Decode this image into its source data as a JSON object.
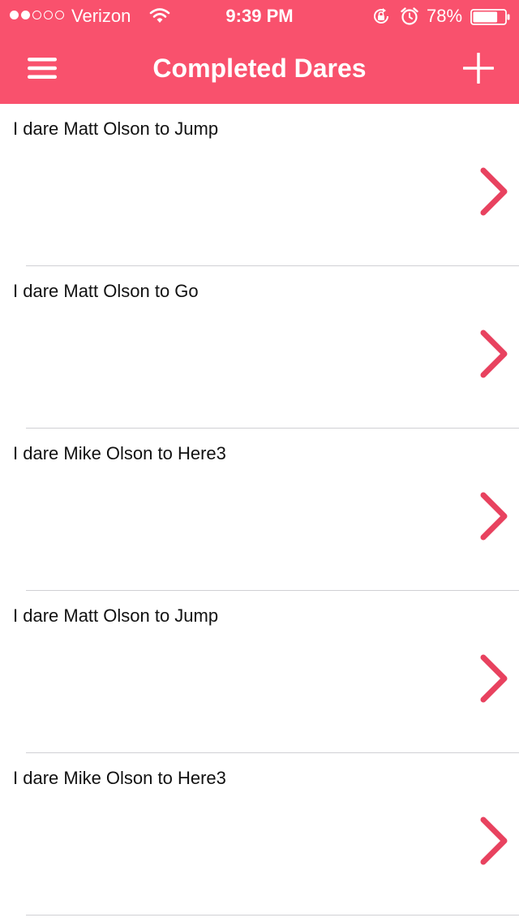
{
  "status_bar": {
    "signal_filled": 2,
    "signal_total": 5,
    "carrier": "Verizon",
    "time": "9:39 PM",
    "battery": "78%",
    "battery_level": 0.78
  },
  "nav": {
    "title": "Completed Dares",
    "menu_icon": "hamburger-menu-icon",
    "add_icon": "plus-icon"
  },
  "dares": [
    {
      "text": "I dare Matt Olson to Jump"
    },
    {
      "text": "I dare Matt Olson to Go"
    },
    {
      "text": "I dare Mike Olson to Here3"
    },
    {
      "text": "I dare Matt Olson to Jump"
    },
    {
      "text": "I dare Mike Olson to Here3"
    }
  ],
  "colors": {
    "header": "#f9516d",
    "accent": "#e8425f",
    "separator": "#d0d0d4"
  }
}
